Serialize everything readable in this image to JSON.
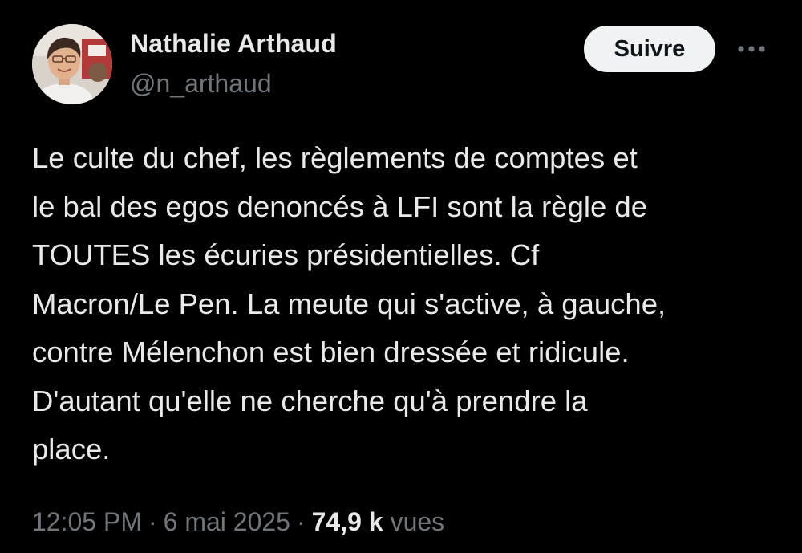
{
  "author": {
    "display_name": "Nathalie Arthaud",
    "handle": "@n_arthaud"
  },
  "actions": {
    "follow_label": "Suivre",
    "more_icon": "more-horizontal-icon"
  },
  "tweet": {
    "text": "Le culte du chef, les règlements de comptes et\nle bal des egos denoncés à LFI sont la règle de\nTOUTES les écuries présidentielles. Cf\nMacron/Le Pen. La meute qui s'active, à gauche,\ncontre Mélenchon est bien dressée et ridicule.\nD'autant qu'elle ne cherche qu'à prendre la\nplace."
  },
  "meta": {
    "time": "12:05 PM",
    "separator": "·",
    "date": "6 mai 2025",
    "views_count": "74,9 k",
    "views_label": "vues"
  },
  "colors": {
    "background": "#000000",
    "primary_text": "#e7e9ea",
    "secondary_text": "#71767b",
    "follow_bg": "#eff3f4",
    "follow_text": "#0f1419"
  }
}
